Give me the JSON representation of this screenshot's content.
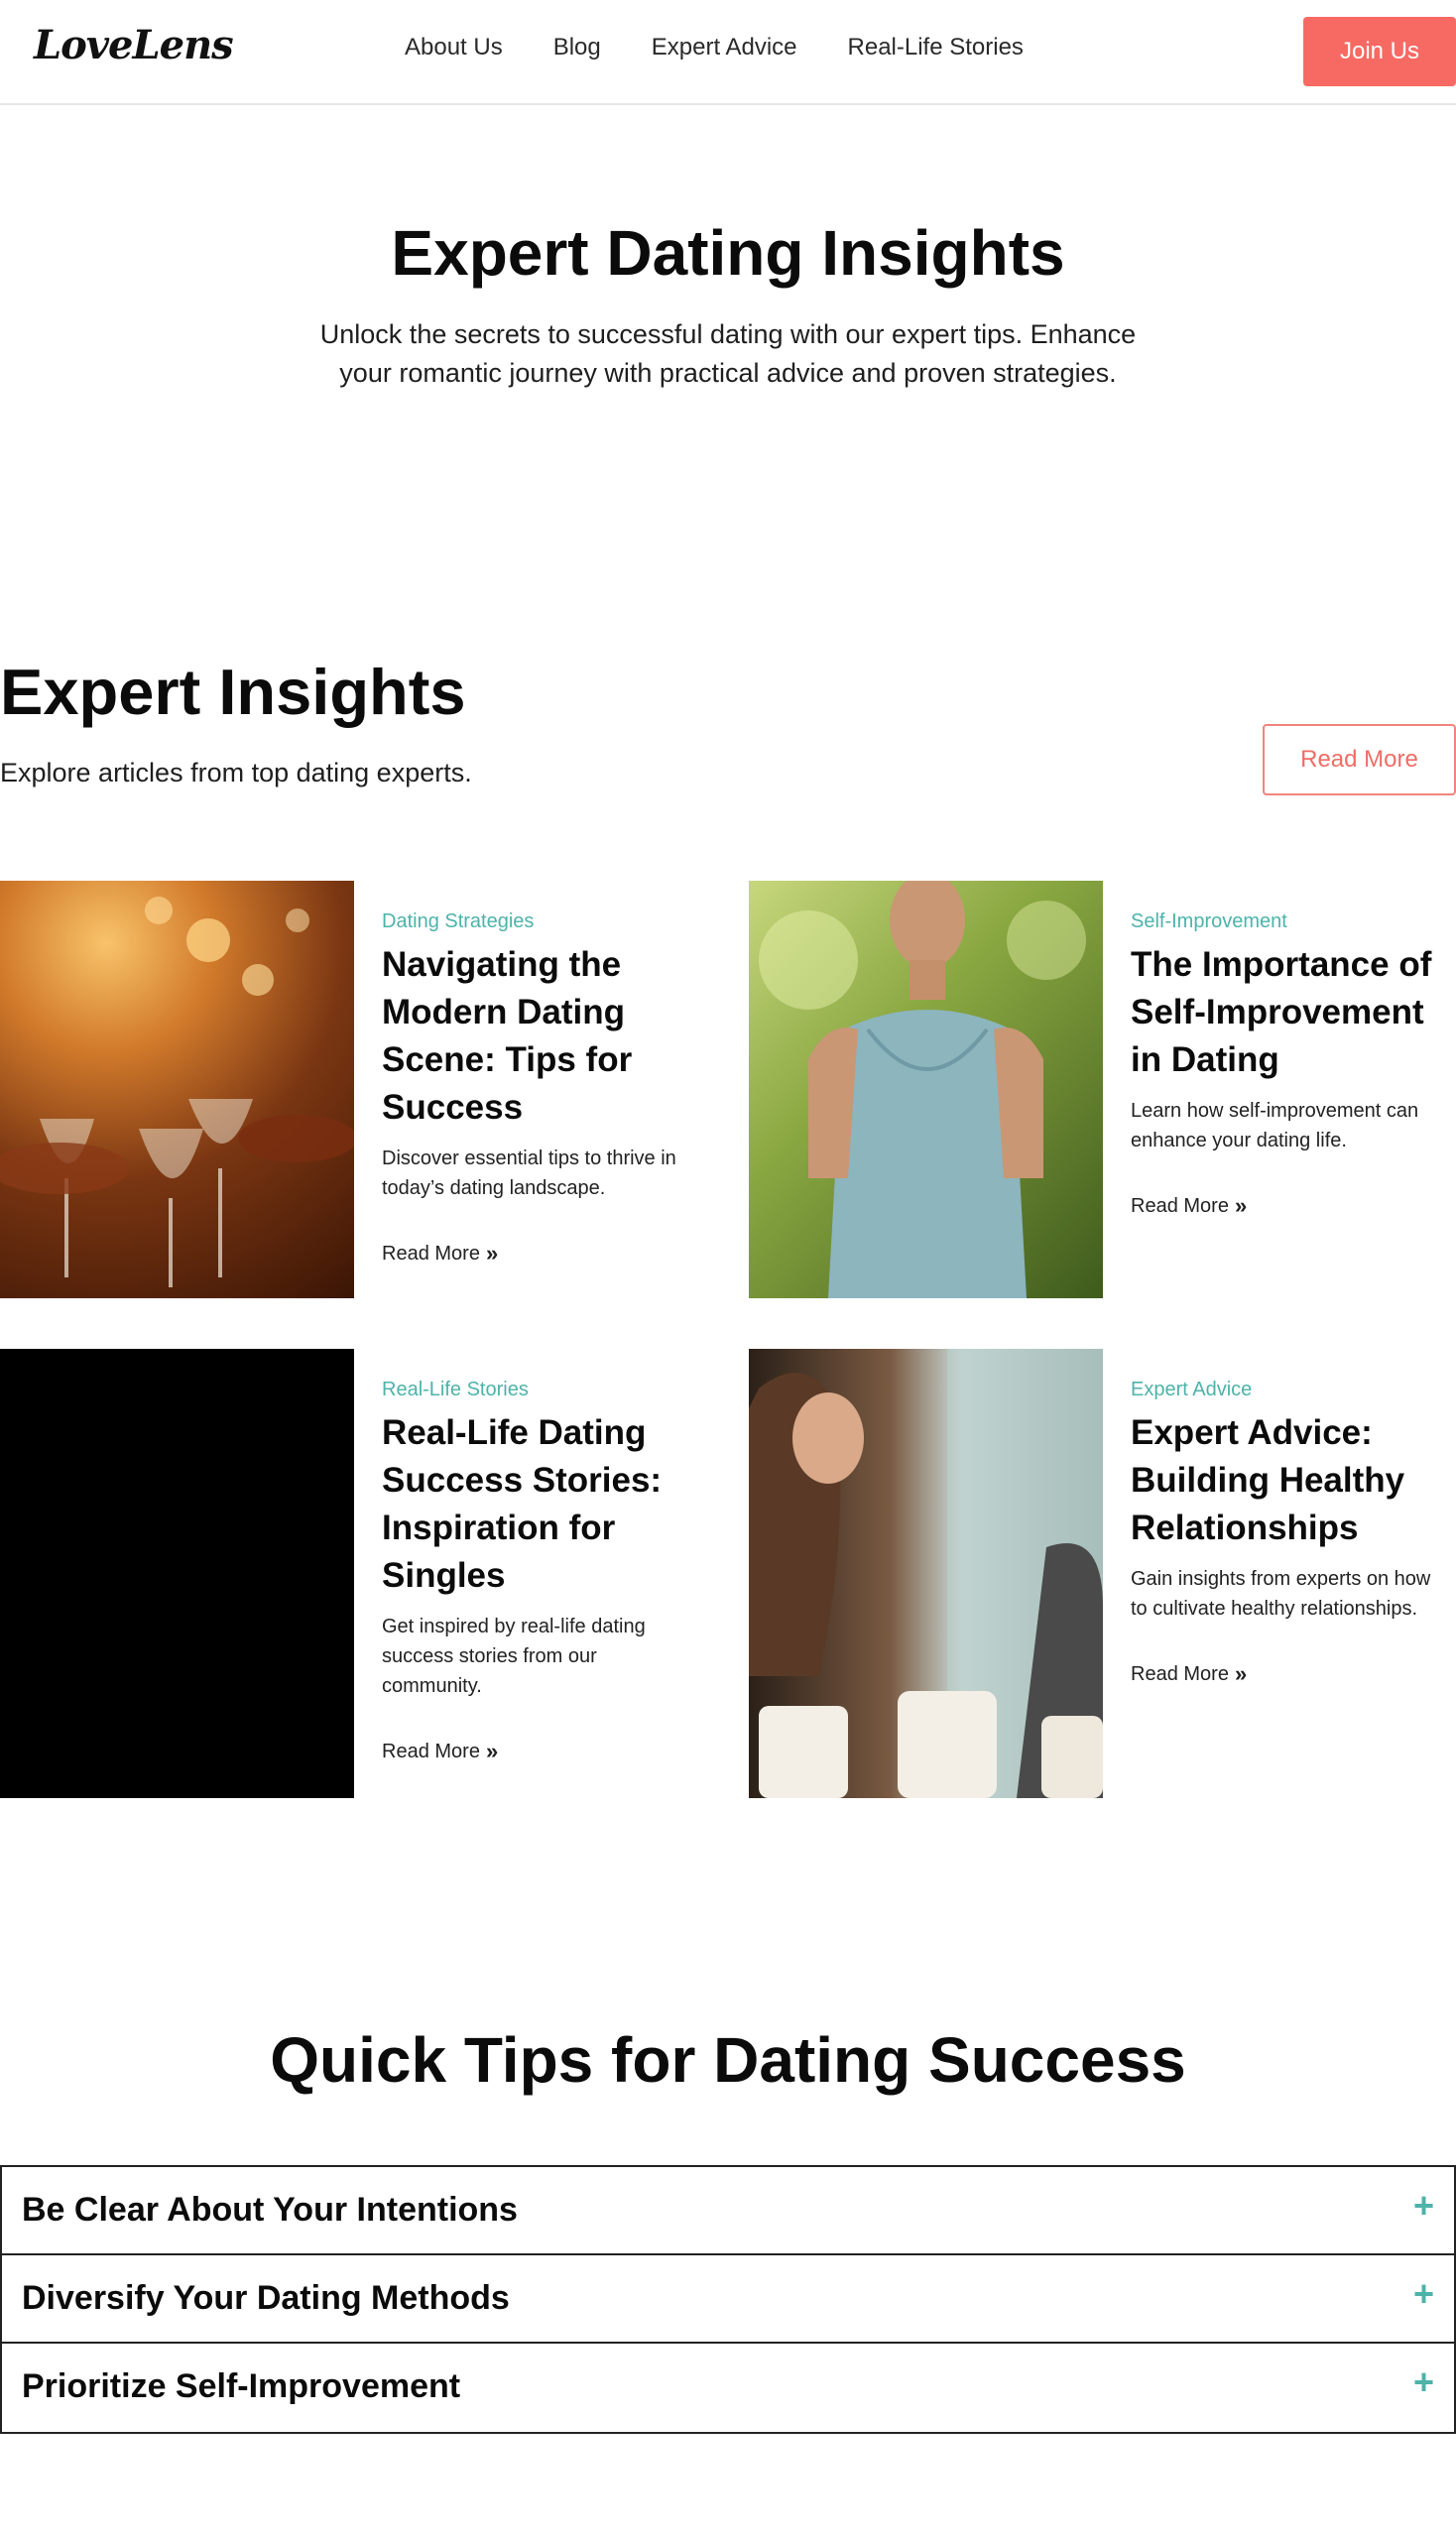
{
  "header": {
    "logo": "LoveLens",
    "nav": [
      "About Us",
      "Blog",
      "Expert Advice",
      "Real-Life Stories"
    ],
    "cta": "Join Us"
  },
  "hero": {
    "title": "Expert Dating Insights",
    "subtitle": "Unlock the secrets to successful dating with our expert tips. Enhance your romantic journey with practical advice and proven strategies."
  },
  "insights": {
    "title": "Expert Insights",
    "subtitle": "Explore articles from top dating experts.",
    "read_more_button": "Read More",
    "cards": [
      {
        "category": "Dating Strategies",
        "title": "Navigating the Modern Dating Scene: Tips for Success",
        "description": "Discover essential tips to thrive in today’s dating landscape.",
        "link": "Read More",
        "image": "wine-glasses-toast"
      },
      {
        "category": "Self-Improvement",
        "title": "The Importance of Self-Improvement in Dating",
        "description": "Learn how self-improvement can enhance your dating life.",
        "link": "Read More",
        "image": "woman-meditating"
      },
      {
        "category": "Real-Life Stories",
        "title": "Real-Life Dating Success Stories: Inspiration for Singles",
        "description": "Get inspired by real-life dating success stories from our community.",
        "link": "Read More",
        "image": "black-placeholder"
      },
      {
        "category": "Expert Advice",
        "title": "Expert Advice: Building Healthy Relationships",
        "description": "Gain insights from experts on how to cultivate healthy relationships.",
        "link": "Read More",
        "image": "couple-coffee"
      }
    ]
  },
  "quick_tips": {
    "title": "Quick Tips for Dating Success",
    "items": [
      {
        "label": "Be Clear About Your Intentions",
        "icon": "plus-icon"
      },
      {
        "label": "Diversify Your Dating Methods",
        "icon": "plus-icon"
      },
      {
        "label": "Prioritize Self-Improvement",
        "icon": "plus-icon"
      }
    ]
  },
  "colors": {
    "accent": "#f76a63",
    "teal": "#4db3a9"
  }
}
